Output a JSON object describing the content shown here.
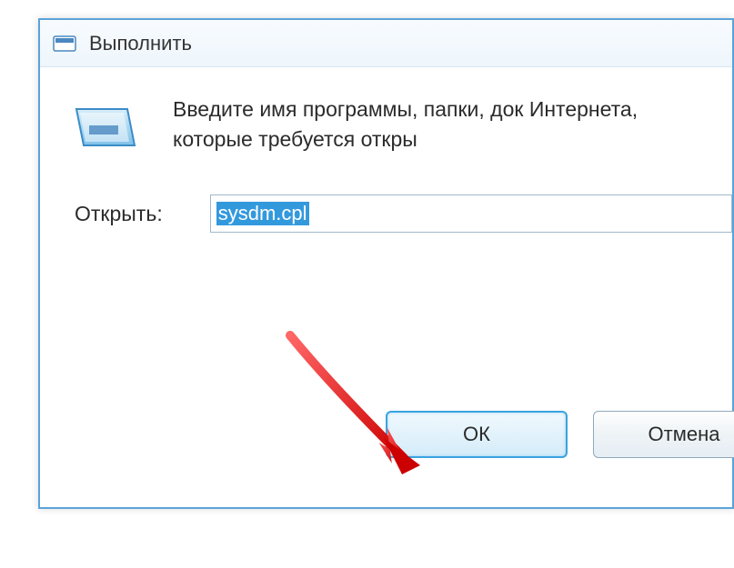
{
  "window": {
    "title": "Выполнить"
  },
  "instruction": {
    "text": "Введите имя программы, папки, док Интернета, которые требуется откры"
  },
  "field": {
    "label": "Открыть:",
    "value": "sysdm.cpl"
  },
  "buttons": {
    "ok": "ОК",
    "cancel": "Отмена"
  }
}
